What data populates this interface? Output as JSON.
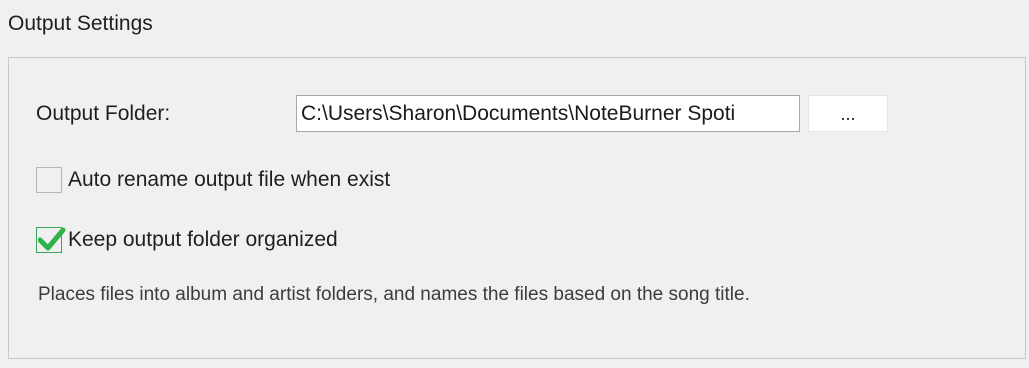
{
  "section": {
    "title": "Output Settings"
  },
  "output_folder": {
    "label": "Output Folder:",
    "value": "C:\\Users\\Sharon\\Documents\\NoteBurner Spoti",
    "browse_label": "..."
  },
  "options": {
    "auto_rename": {
      "label": "Auto rename output file when exist",
      "checked": false
    },
    "keep_organized": {
      "label": "Keep output folder organized",
      "checked": true,
      "check_color": "#2fb24c"
    }
  },
  "description": "Places files into album and artist folders, and names the files based on the song title."
}
